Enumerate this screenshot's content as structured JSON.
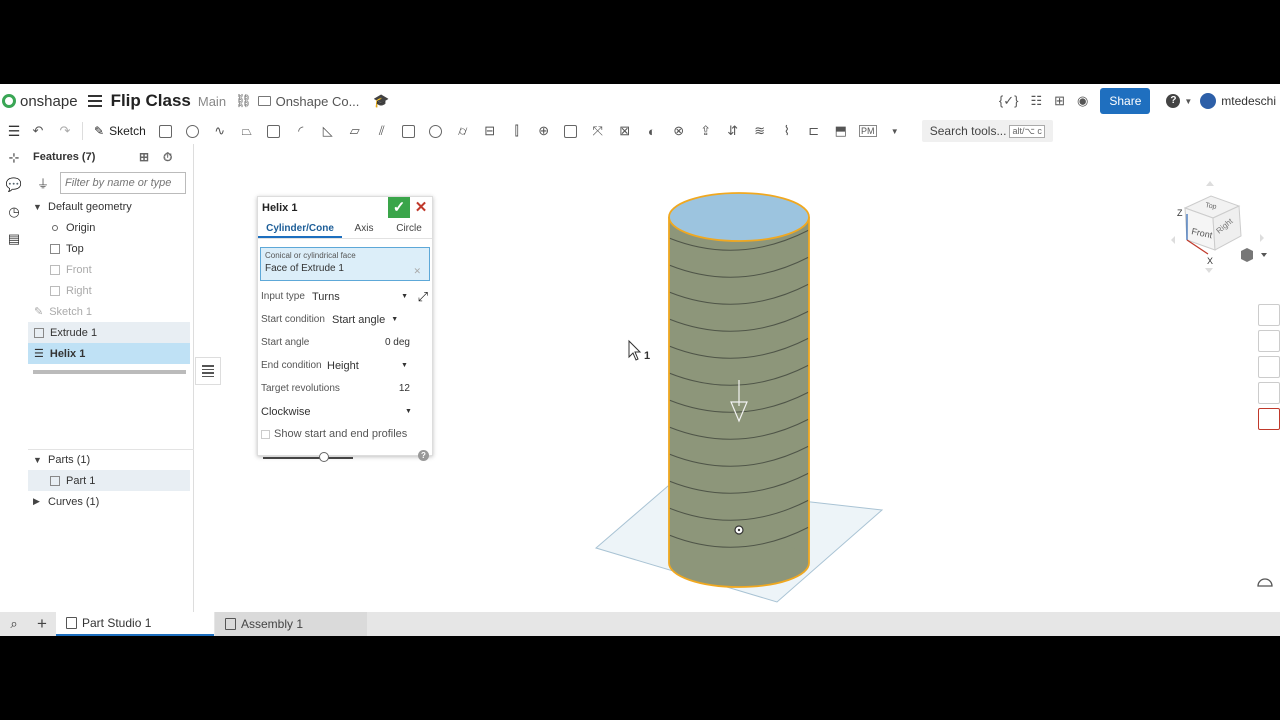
{
  "header": {
    "brand": "onshape",
    "doc_title": "Flip Class",
    "workspace": "Main",
    "folder": "Onshape Co...",
    "share_label": "Share",
    "help_label": "?",
    "user": "mtedeschi"
  },
  "toolbar": {
    "sketch_label": "Sketch",
    "search_label": "Search tools...",
    "search_shortcut": "alt/⌥ c",
    "pm_label": "PM"
  },
  "features": {
    "title": "Features (7)",
    "filter_placeholder": "Filter by name or type",
    "default_geometry": "Default geometry",
    "items": [
      "Origin",
      "Top",
      "Front",
      "Right",
      "Sketch 1",
      "Extrude 1",
      "Helix 1"
    ],
    "parts_header": "Parts (1)",
    "part": "Part 1",
    "curves_header": "Curves (1)"
  },
  "dialog": {
    "title": "Helix 1",
    "tabs": [
      "Cylinder/Cone",
      "Axis",
      "Circle"
    ],
    "face_label": "Conical or cylindrical face",
    "face_value": "Face of Extrude 1",
    "input_type_label": "Input type",
    "input_type_value": "Turns",
    "start_condition_label": "Start condition",
    "start_condition_value": "Start angle",
    "start_angle_label": "Start angle",
    "start_angle_value": "0 deg",
    "end_condition_label": "End condition",
    "end_condition_value": "Height",
    "target_rev_label": "Target revolutions",
    "target_rev_value": "12",
    "direction_value": "Clockwise",
    "show_profiles_label": "Show start and end profiles",
    "show_profiles_checked": false,
    "opacity_slider_value": 0.68
  },
  "viewcube": {
    "top": "Top",
    "front": "Front",
    "right": "Right",
    "axis_z": "Z",
    "axis_x": "X"
  },
  "cursor_badge": "1",
  "tabs": {
    "part_studio": "Part Studio 1",
    "assembly": "Assembly 1"
  },
  "colors": {
    "accent": "#1f6fbf",
    "confirm": "#3aa54a",
    "cancel": "#c0392b",
    "selection": "#bfe1f5",
    "cylinder_side": "#8d967a",
    "cylinder_top": "#9cc4df",
    "highlight_edge": "#f0a820"
  }
}
